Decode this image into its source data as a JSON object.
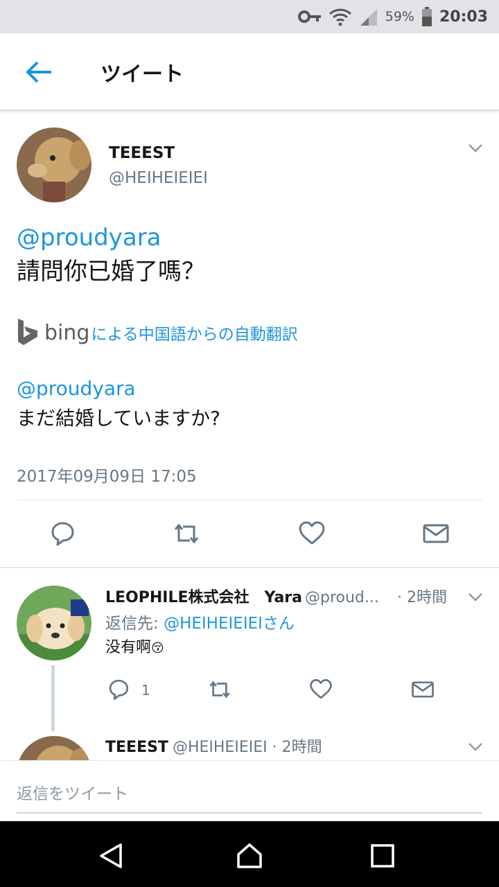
{
  "status_bar": {
    "battery": "59%",
    "time": "20:03"
  },
  "app_bar": {
    "title": "ツイート"
  },
  "main_tweet": {
    "name": "TEEEST",
    "handle": "@HEIHEIEIEI",
    "mention": "@proudyara",
    "text": "請問你已婚了嗎？",
    "translation_brand": "bing",
    "translation_link": "による中国語からの自動翻訳",
    "translated_mention": "@proudyara",
    "translated_text": "まだ結婚していますか?",
    "timestamp": "2017年09月09日 17:05"
  },
  "reply1": {
    "name": "LEOPHILE株式会社",
    "name2": "Yara",
    "handle": "@proud...",
    "time": "· 2時間",
    "reply_to_label": "返信先: ",
    "reply_to_handle": "@HEIHEIEIEIさん",
    "text": "没有啊",
    "emoji": "😚",
    "reply_count": "1"
  },
  "reply2": {
    "name": "TEEEST",
    "handle": "@HEIHEIEIEI · 2時間"
  },
  "composer": {
    "placeholder": "返信をツイート"
  },
  "colors": {
    "accent": "#1b95e0",
    "secondary_text": "#657786",
    "icon": "#657786"
  }
}
